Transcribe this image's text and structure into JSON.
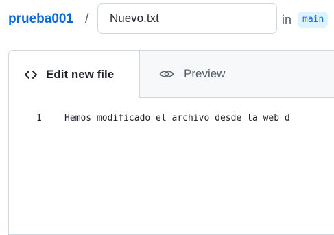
{
  "header": {
    "repo_name": "prueba001",
    "path_separator": "/",
    "filename_value": "Nuevo.txt",
    "in_label": "in",
    "branch": "main"
  },
  "tabs": [
    {
      "label": "Edit new file",
      "icon": "code-icon",
      "active": true
    },
    {
      "label": "Preview",
      "icon": "eye-icon",
      "active": false
    }
  ],
  "editor": {
    "lines": [
      {
        "number": "1",
        "text": "Hemos modificado el archivo desde la web d"
      }
    ]
  },
  "colors": {
    "link": "#0969da",
    "branch_bg": "#ddf4ff",
    "border": "#d0d7de",
    "tab_bg": "#f6f8fa",
    "muted_text": "#57606a"
  }
}
